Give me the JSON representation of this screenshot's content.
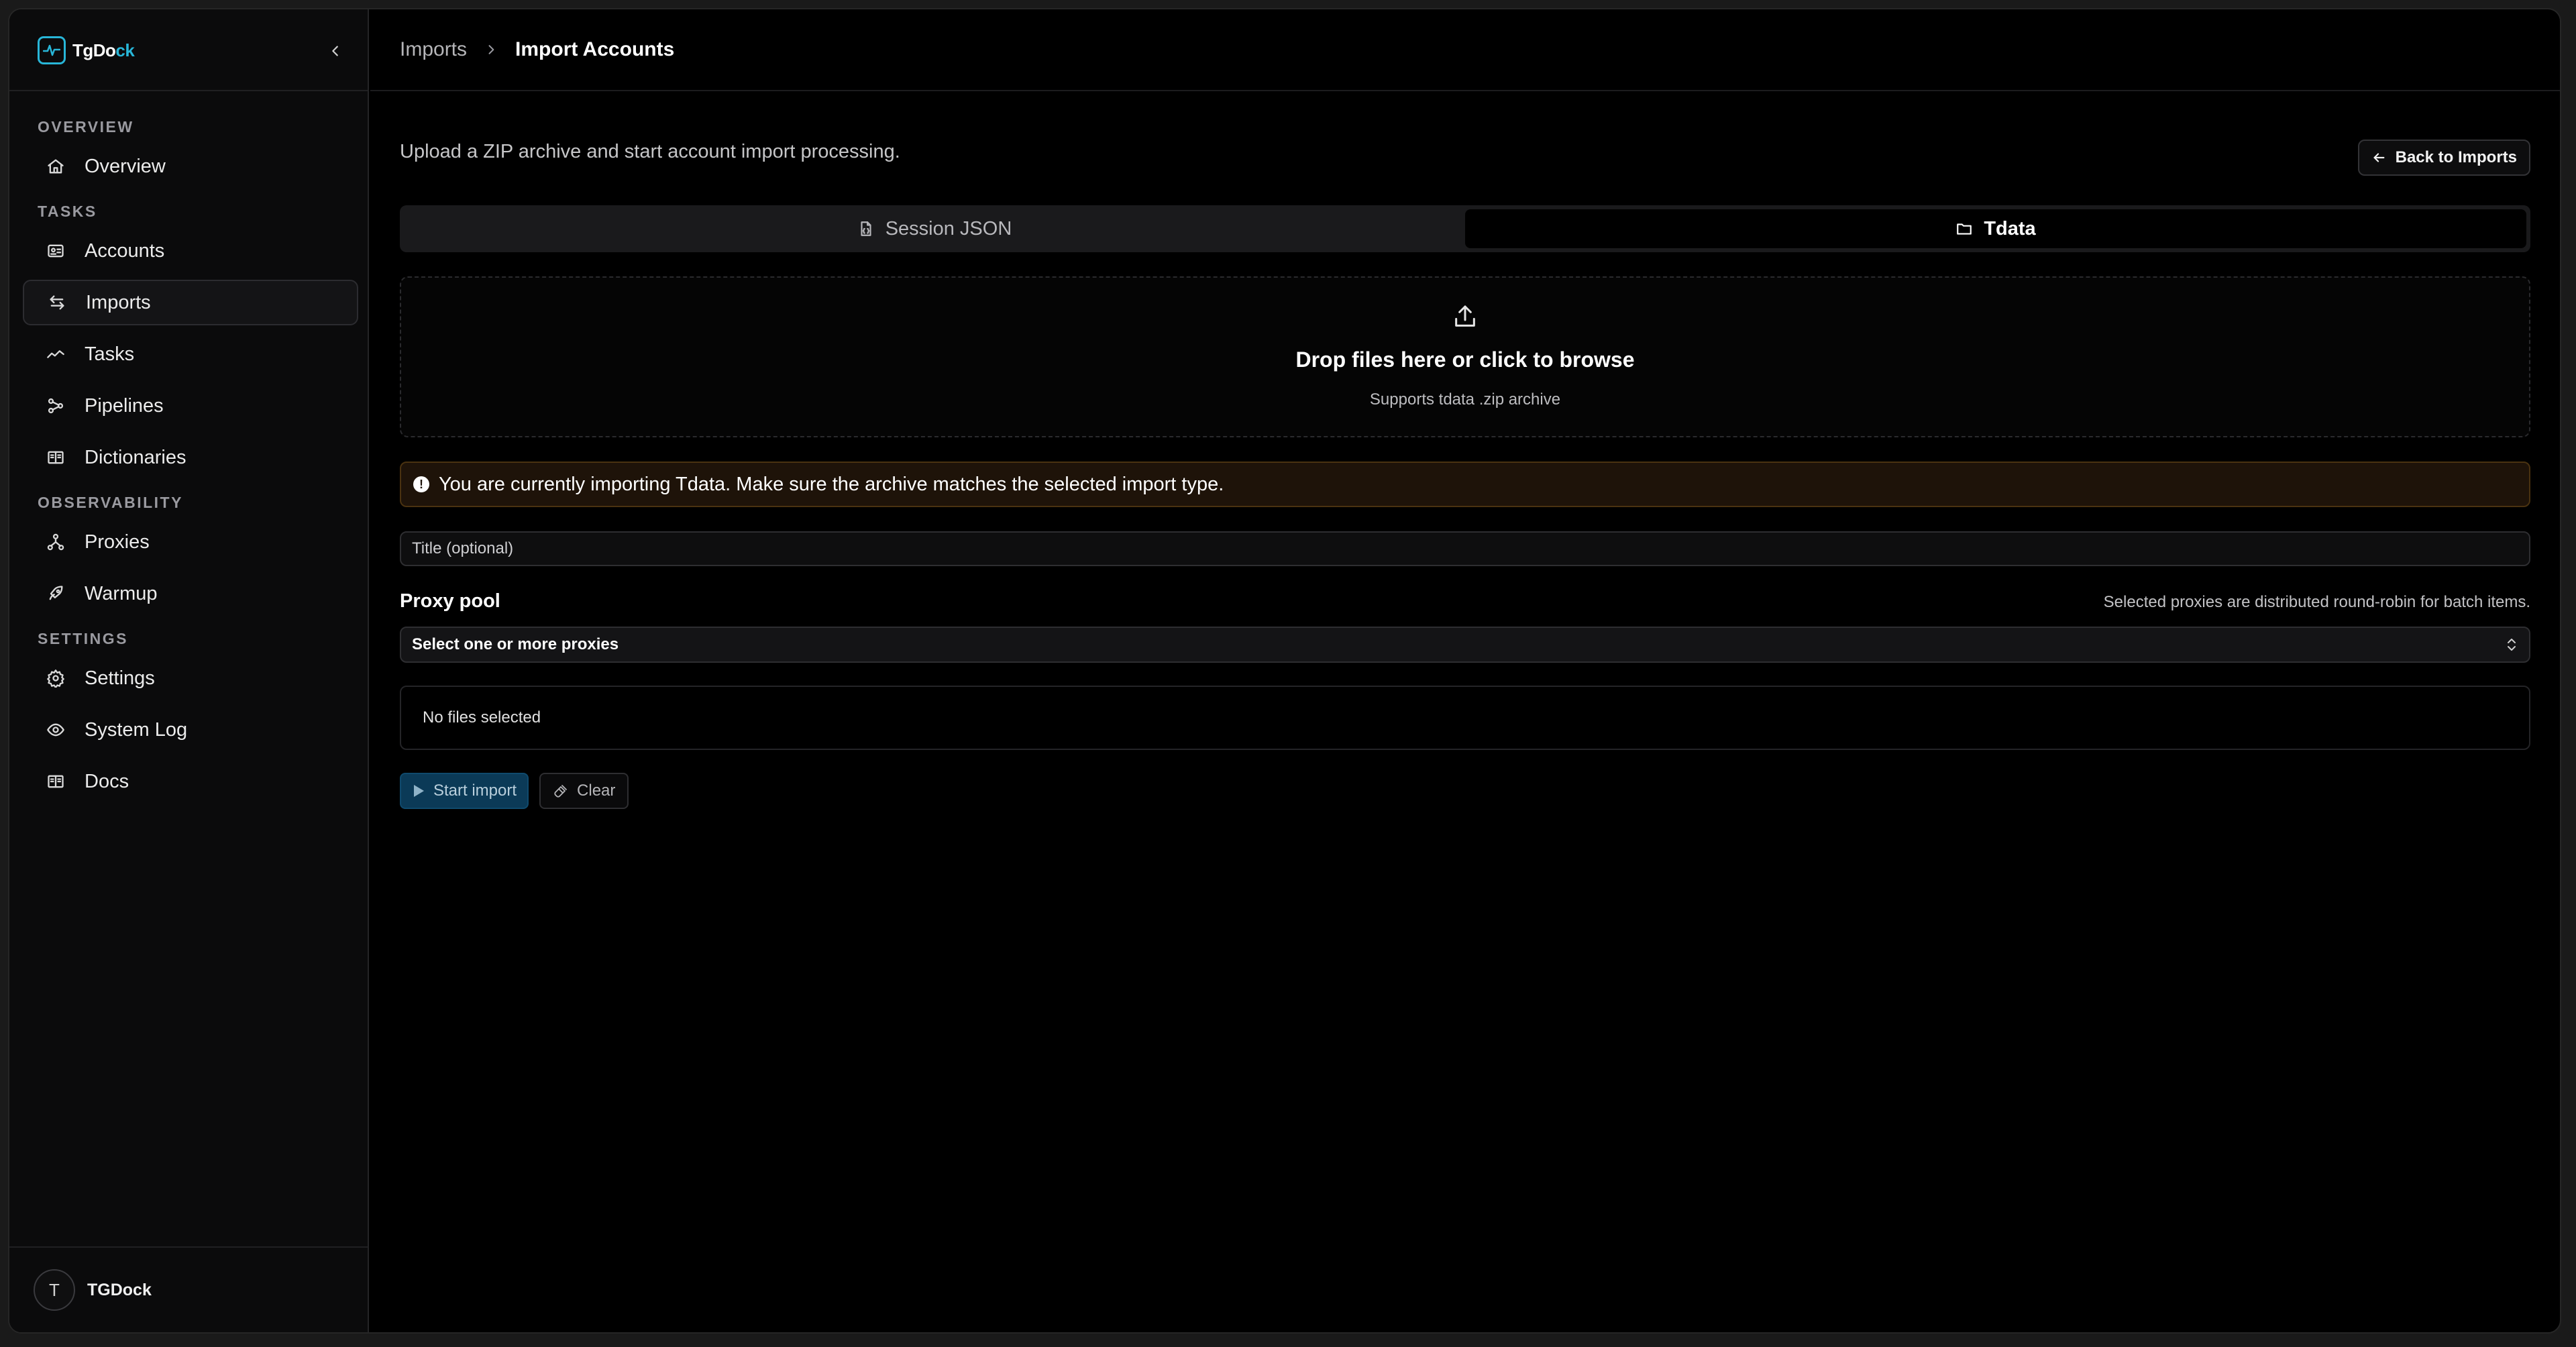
{
  "app": {
    "name_part1": "TgDo",
    "name_part2": "ck",
    "accent": "#28b6d8"
  },
  "sidebar": {
    "sections": {
      "overview": "OVERVIEW",
      "tasks": "TASKS",
      "observability": "OBSERVABILITY",
      "settings": "SETTINGS"
    },
    "items": [
      {
        "label": "Overview",
        "icon": "home-icon"
      },
      {
        "label": "Accounts",
        "icon": "id-card-icon"
      },
      {
        "label": "Imports",
        "icon": "arrows-swap-icon",
        "active": true
      },
      {
        "label": "Tasks",
        "icon": "trend-line-icon"
      },
      {
        "label": "Pipelines",
        "icon": "workflow-icon"
      },
      {
        "label": "Dictionaries",
        "icon": "book-icon"
      },
      {
        "label": "Proxies",
        "icon": "network-icon"
      },
      {
        "label": "Warmup",
        "icon": "rocket-icon"
      },
      {
        "label": "Settings",
        "icon": "gear-icon"
      },
      {
        "label": "System Log",
        "icon": "eye-icon"
      },
      {
        "label": "Docs",
        "icon": "book-open-icon"
      }
    ],
    "user": {
      "initial": "T",
      "name": "TGDock"
    }
  },
  "breadcrumb": {
    "parent": "Imports",
    "current": "Import Accounts"
  },
  "page": {
    "subtitle": "Upload a ZIP archive and start account import processing.",
    "back_button": "Back to Imports"
  },
  "tabs": [
    {
      "label": "Session JSON",
      "icon": "file-json-icon",
      "active": false
    },
    {
      "label": "Tdata",
      "icon": "folder-icon",
      "active": true
    }
  ],
  "dropzone": {
    "title": "Drop files here or click to browse",
    "subtitle": "Supports tdata .zip archive"
  },
  "alert": {
    "text": "You are currently importing Tdata. Make sure the archive matches the selected import type.",
    "color": "#4a3210"
  },
  "form": {
    "title_placeholder": "Title (optional)",
    "proxy_label": "Proxy pool",
    "proxy_hint": "Selected proxies are distributed round-robin for batch items.",
    "proxy_select": "Select one or more proxies",
    "files_status": "No files selected"
  },
  "actions": {
    "start": "Start import",
    "clear": "Clear"
  }
}
